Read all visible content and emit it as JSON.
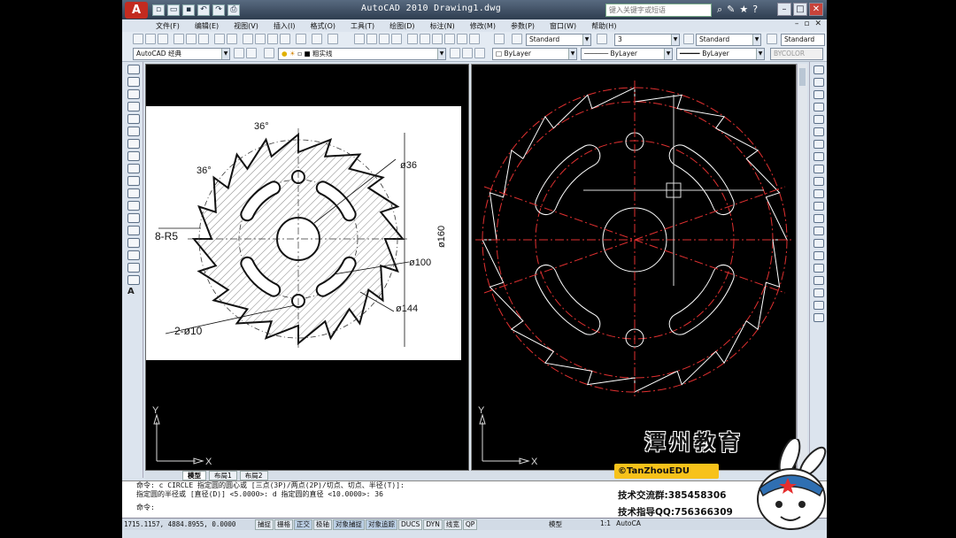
{
  "app": {
    "title": "AutoCAD 2010  Drawing1.dwg",
    "search_placeholder": "键入关键字或短语",
    "logo": "A"
  },
  "menu": [
    "文件(F)",
    "编辑(E)",
    "视图(V)",
    "插入(I)",
    "格式(O)",
    "工具(T)",
    "绘图(D)",
    "标注(N)",
    "修改(M)",
    "参数(P)",
    "窗口(W)",
    "帮助(H)"
  ],
  "toolbar": {
    "text_style": "Standard",
    "dim_style": "3",
    "table_style": "Standard",
    "multileader_style": "Standard",
    "workspace": "AutoCAD 经典",
    "layer": "粗实线",
    "color": "ByLayer",
    "linetype": "ByLayer",
    "lineweight": "ByLayer",
    "plotstyle": "BYCOLOR"
  },
  "reference_drawing": {
    "labels": [
      "36°",
      "36°",
      "ø36",
      "8-R5",
      "ø160",
      "ø100",
      "ø144",
      "2-ø10"
    ]
  },
  "axes": {
    "y": "Y",
    "x": "X"
  },
  "tabs": [
    "模型",
    "布局1",
    "布局2"
  ],
  "command_history": [
    "命令: c CIRCLE 指定圆的圆心或 [三点(3P)/两点(2P)/切点、切点、半径(T)]:",
    "指定圆的半径或 [直径(D)] <5.0000>: d 指定圆的直径 <10.0000>: 36",
    "命令:"
  ],
  "status": {
    "coords": "1715.1157, 4884.8955, 0.0000",
    "toggles": [
      "捕捉",
      "栅格",
      "正交",
      "极轴",
      "对象捕捉",
      "对象追踪",
      "DUCS",
      "DYN",
      "线宽",
      "QP"
    ],
    "active_toggles": [
      "正交",
      "对象捕捉",
      "对象追踪"
    ],
    "space": "模型",
    "scale": "1:1",
    "workspace_short": "AutoCA"
  },
  "watermark": {
    "title": "潭州教育",
    "handle": "©TanZhouEDU",
    "group": "技术交流群:385458306",
    "qq": "技术指导QQ:756366309"
  }
}
